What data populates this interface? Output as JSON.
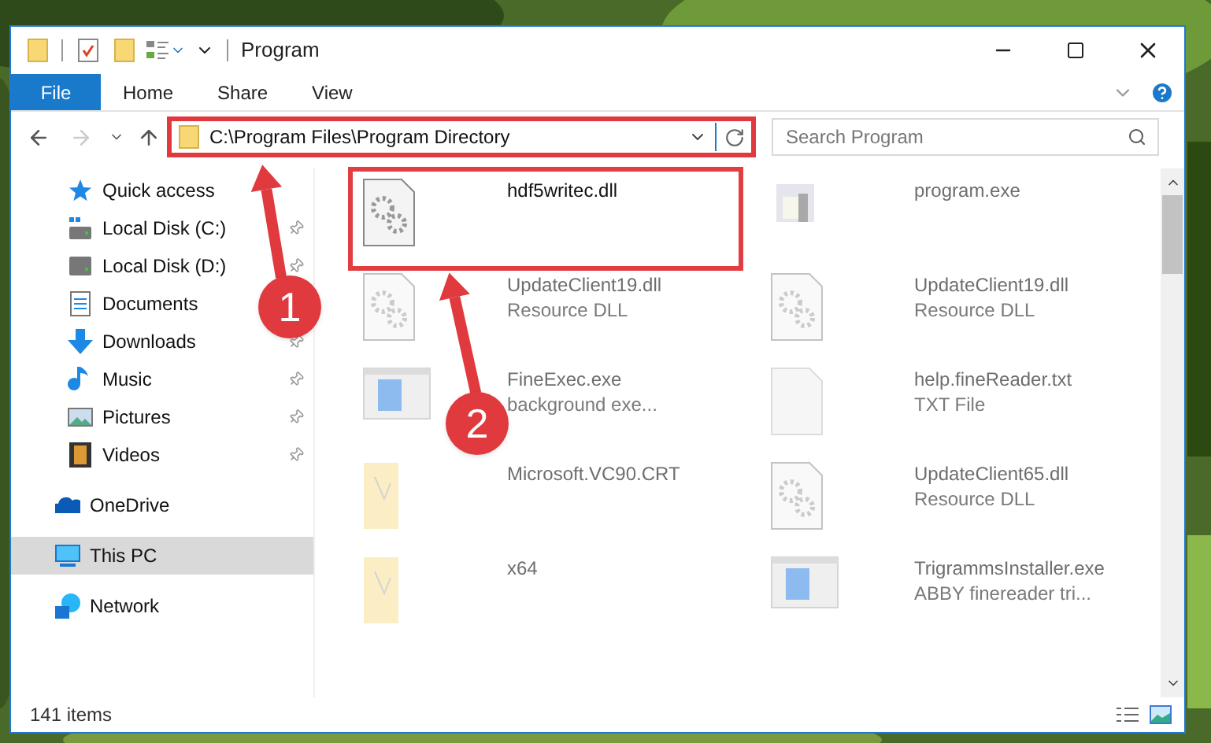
{
  "window": {
    "title": "Program"
  },
  "ribbon_tabs": [
    {
      "label": "File",
      "kind": "file"
    },
    {
      "label": "Home",
      "kind": "tab"
    },
    {
      "label": "Share",
      "kind": "tab"
    },
    {
      "label": "View",
      "kind": "tab"
    }
  ],
  "address": {
    "value": "C:\\Program Files\\Program Directory",
    "highlighted": true
  },
  "search": {
    "placeholder": "Search Program"
  },
  "sidebar": {
    "items": [
      {
        "label": "Quick access",
        "kind": "star",
        "selected": false,
        "children": [
          {
            "label": "Local Disk (C:)",
            "kind": "disk-c",
            "pinned": true,
            "selected": false
          },
          {
            "label": "Local Disk (D:)",
            "kind": "disk",
            "pinned": true,
            "selected": false
          },
          {
            "label": "Documents",
            "kind": "doc",
            "selected": false
          },
          {
            "label": "Downloads",
            "kind": "download",
            "pinned": true,
            "selected": false
          },
          {
            "label": "Music",
            "kind": "music",
            "pinned": true,
            "selected": false
          },
          {
            "label": "Pictures",
            "kind": "pictures",
            "pinned": true,
            "selected": false
          },
          {
            "label": "Videos",
            "kind": "videos",
            "pinned": true,
            "selected": false
          }
        ]
      },
      {
        "label": "OneDrive",
        "kind": "cloud",
        "selected": false
      },
      {
        "label": "This PC",
        "kind": "pc",
        "selected": true
      },
      {
        "label": "Network",
        "kind": "network",
        "selected": false
      }
    ]
  },
  "files": [
    {
      "name": "hdf5writec.dll",
      "kind": "dll",
      "faded": false,
      "highlighted": true
    },
    {
      "name": "program.exe",
      "kind": "program",
      "faded": true,
      "highlighted": false
    },
    {
      "name": "UpdateClient19.dll",
      "type": "Resource DLL",
      "kind": "dll",
      "faded": true,
      "highlighted": false
    },
    {
      "name": "UpdateClient19.dll",
      "type": "Resource DLL",
      "kind": "dll",
      "faded": true,
      "highlighted": false
    },
    {
      "name": "FineExec.exe",
      "type": "background exe...",
      "kind": "window",
      "faded": true,
      "highlighted": false
    },
    {
      "name": "help.fineReader.txt",
      "type": "TXT File",
      "kind": "txt",
      "faded": true,
      "highlighted": false
    },
    {
      "name": "Microsoft.VC90.CRT",
      "kind": "folder",
      "faded": true,
      "highlighted": false
    },
    {
      "name": "UpdateClient65.dll",
      "type": "Resource DLL",
      "kind": "dll",
      "faded": true,
      "highlighted": false
    },
    {
      "name": "x64",
      "kind": "folder",
      "faded": true,
      "highlighted": false
    },
    {
      "name": "TrigrammsInstaller.exe",
      "type": "ABBY finereader tri...",
      "kind": "window",
      "faded": true,
      "highlighted": false
    }
  ],
  "status_bar": {
    "count": "141 items"
  },
  "annotations": [
    {
      "label": "1"
    },
    {
      "label": "2"
    }
  ]
}
